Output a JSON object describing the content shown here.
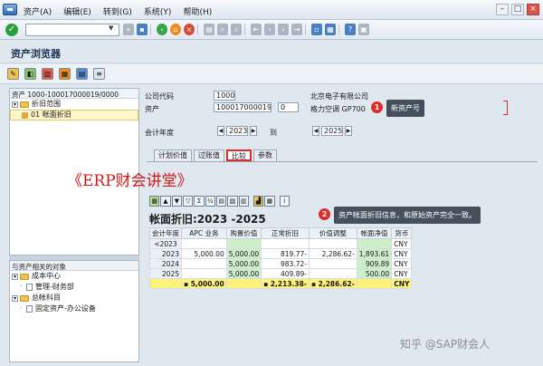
{
  "menu": {
    "items": [
      "资产(A)",
      "编辑(E)",
      "转到(G)",
      "系统(Y)",
      "帮助(H)"
    ]
  },
  "toolbar": {
    "command_value": ""
  },
  "page": {
    "title": "资产浏览器"
  },
  "tree": {
    "header": "资产 1000-100017000019/0000",
    "nodes": [
      {
        "label": "折旧范围",
        "expander": "▾"
      },
      {
        "label": "01 帐面折旧"
      }
    ]
  },
  "tree2": {
    "header": "与资产相关的对象",
    "nodes": [
      {
        "label": "成本中心",
        "expander": "▾"
      },
      {
        "label": "管理-财务部",
        "expander": "·"
      },
      {
        "label": "总帐科目",
        "expander": "▾"
      },
      {
        "label": "固定资产-办公设备",
        "expander": "·"
      }
    ]
  },
  "form": {
    "company_code_label": "公司代码",
    "company_code": "1000",
    "company_name": "北京电子有限公司",
    "asset_label": "资产",
    "asset_no": "100017000019",
    "asset_sub": "0",
    "asset_desc": "格力空调 GP700",
    "fiscal_year_label": "会计年度",
    "fiscal_year_from": "2023",
    "to_label": "到",
    "fiscal_year_to": "2025"
  },
  "callouts": {
    "one_badge": "1",
    "one_text": "新资产号",
    "two_badge": "2",
    "two_text": "资产帐面折旧信息，和原始资产完全一致。"
  },
  "tabs": [
    {
      "label": "计划价值"
    },
    {
      "label": "过账值"
    },
    {
      "label": "比较",
      "active": true
    },
    {
      "label": "参数"
    }
  ],
  "watermark": "《ERP财会讲堂》",
  "alv": {
    "title": "帐面折旧:2023 -2025",
    "columns": [
      "会计年度",
      "APC 业务",
      "购置价值",
      "正常折旧",
      "价值调整",
      "帐面净值",
      "货币"
    ],
    "rows": [
      [
        "<2023",
        "",
        "",
        "",
        "",
        "",
        "CNY"
      ],
      [
        "2023",
        "5,000.00",
        "5,000.00",
        "819.77-",
        "2,286.62-",
        "1,893.61",
        "CNY"
      ],
      [
        "2024",
        "",
        "5,000.00",
        "983.72-",
        "",
        "909.89",
        "CNY"
      ],
      [
        "2025",
        "",
        "5,000.00",
        "409.89-",
        "",
        "500.00",
        "CNY"
      ]
    ],
    "total": [
      "",
      "▪ 5,000.00",
      "",
      "▪ 2,213.38-",
      "▪ 2,286.62-",
      "",
      "CNY"
    ]
  },
  "brand": "知乎 @SAP财会人"
}
